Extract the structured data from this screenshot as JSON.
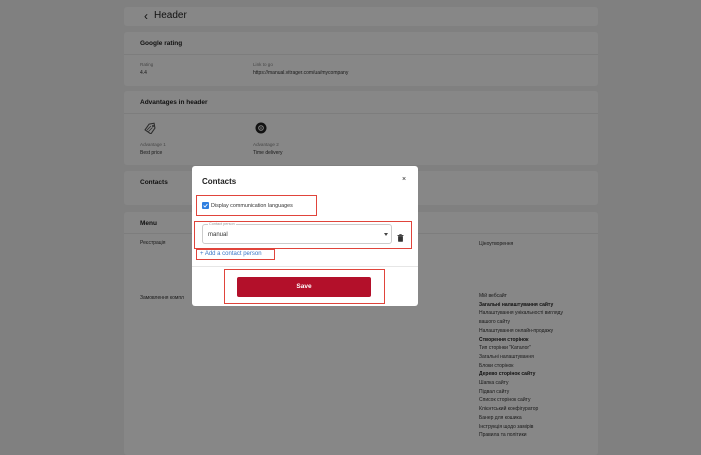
{
  "header": {
    "title": "Header"
  },
  "google_rating": {
    "title": "Google rating",
    "rating_label": "Rating",
    "rating_value": "4.4",
    "link_label": "Link to go",
    "link_value": "https://manual.vitrager.com/ua/mycompany"
  },
  "advantages": {
    "title": "Advantages in header",
    "items": [
      {
        "label": "Advantage 1",
        "value": "Best price",
        "icon": "price-tag-icon"
      },
      {
        "label": "Advantage 2",
        "value": "Time delivery",
        "icon": "delivery-icon"
      }
    ]
  },
  "contacts_card": {
    "title": "Contacts"
  },
  "menu": {
    "title": "Menu",
    "left_items": [
      "Реєстрація",
      "Замовлення компл"
    ],
    "right_top": "Ціноутворення",
    "right_items": [
      {
        "text": "Мій вебсайт",
        "bold": false
      },
      {
        "text": "Загальні налаштування сайту",
        "bold": true
      },
      {
        "text": "Налаштування унікальності вигляду",
        "bold": false
      },
      {
        "text": "вашого сайту",
        "bold": false
      },
      {
        "text": "Налаштування онлайн-продажу",
        "bold": false
      },
      {
        "text": "Створення сторінок",
        "bold": true
      },
      {
        "text": "Тип сторінки \"Каталог\"",
        "bold": false
      },
      {
        "text": "Загальні налаштування",
        "bold": false
      },
      {
        "text": "Блоки сторінок",
        "bold": false
      },
      {
        "text": "Дерево сторінок сайту",
        "bold": true
      },
      {
        "text": "Шапка сайту",
        "bold": false
      },
      {
        "text": "Підвал сайту",
        "bold": false
      },
      {
        "text": "Список сторінок сайту",
        "bold": false
      },
      {
        "text": "Клієнтський конфігуратор",
        "bold": false
      },
      {
        "text": "Банер для кошика",
        "bold": false
      },
      {
        "text": "Інструкція щодо замірів",
        "bold": false
      },
      {
        "text": "Правила та політики",
        "bold": false
      }
    ]
  },
  "modal": {
    "title": "Contacts",
    "close": "×",
    "checkbox_label": "Display communication languages",
    "checkbox_checked": true,
    "contact_person_label": "Contact person",
    "contact_person_value": "manual",
    "add_contact_label": "+ Add a contact person",
    "save_label": "Save"
  },
  "colors": {
    "accent": "#b3102a",
    "link": "#3a77c6",
    "highlight": "#e0443b",
    "checkbox": "#2f7fe0"
  }
}
